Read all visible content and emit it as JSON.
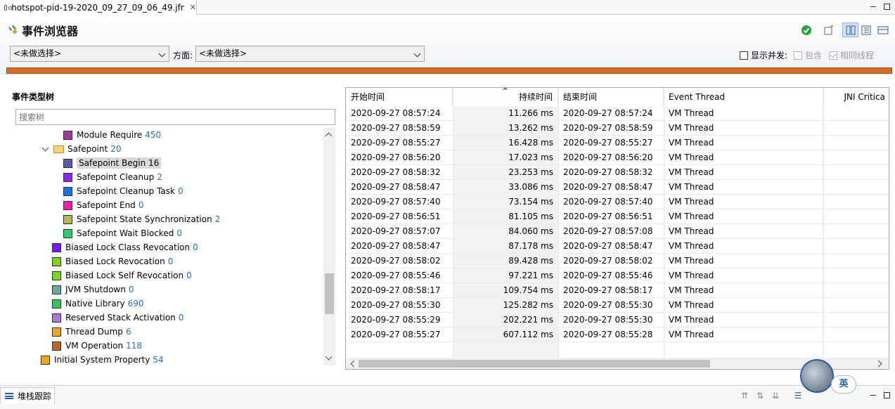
{
  "editor_tab": {
    "title": "hotspot-pid-19-2020_09_27_09_06_49.jfr",
    "close": "✕"
  },
  "header": {
    "title": "事件浏览器",
    "combo1": "<未做选择>",
    "aspect_label": "方面:",
    "combo2": "<未做选择>",
    "show_concurrent": "显示并发:",
    "contains": "包含",
    "same_thread": "相同线程"
  },
  "tree": {
    "title": "事件类型树",
    "search_placeholder": "搜索树",
    "nodes": [
      {
        "label": "Module Require",
        "count": "450",
        "color": "#a23a98"
      },
      {
        "label": "Safepoint",
        "count": "20"
      },
      {
        "label": "Safepoint Begin",
        "count": "16",
        "color": "#5b5aa8"
      },
      {
        "label": "Safepoint Cleanup",
        "count": "2",
        "color": "#8a2be2"
      },
      {
        "label": "Safepoint Cleanup Task",
        "count": "0",
        "color": "#1e6fd9"
      },
      {
        "label": "Safepoint End",
        "count": "0",
        "color": "#ff1aa6"
      },
      {
        "label": "Safepoint State Synchronization",
        "count": "2",
        "color": "#b5b55a"
      },
      {
        "label": "Safepoint Wait Blocked",
        "count": "0",
        "color": "#2fd06a"
      },
      {
        "label": "Biased Lock Class Revocation",
        "count": "0",
        "color": "#6f1cff"
      },
      {
        "label": "Biased Lock Revocation",
        "count": "0",
        "color": "#7ed321"
      },
      {
        "label": "Biased Lock Self Revocation",
        "count": "0",
        "color": "#7ed321"
      },
      {
        "label": "JVM Shutdown",
        "count": "0",
        "color": "#6aa8a0"
      },
      {
        "label": "Native Library",
        "count": "690",
        "color": "#35c45a"
      },
      {
        "label": "Reserved Stack Activation",
        "count": "0",
        "color": "#a77bd6"
      },
      {
        "label": "Thread Dump",
        "count": "6",
        "color": "#f5a524"
      },
      {
        "label": "VM Operation",
        "count": "118",
        "color": "#b8692a"
      },
      {
        "label": "Initial System Property",
        "count": "54",
        "color": "#f5a524"
      }
    ]
  },
  "table": {
    "columns": [
      "开始时间",
      "持续时间",
      "结束时间",
      "Event Thread",
      "JNI Critica"
    ],
    "sort_indicator": "^",
    "rows": [
      [
        "2020-09-27 08:57:24",
        "11.266 ms",
        "2020-09-27 08:57:24",
        "VM Thread"
      ],
      [
        "2020-09-27 08:58:59",
        "13.262 ms",
        "2020-09-27 08:58:59",
        "VM Thread"
      ],
      [
        "2020-09-27 08:55:27",
        "16.428 ms",
        "2020-09-27 08:55:27",
        "VM Thread"
      ],
      [
        "2020-09-27 08:56:20",
        "17.023 ms",
        "2020-09-27 08:56:20",
        "VM Thread"
      ],
      [
        "2020-09-27 08:58:32",
        "23.253 ms",
        "2020-09-27 08:58:32",
        "VM Thread"
      ],
      [
        "2020-09-27 08:58:47",
        "33.086 ms",
        "2020-09-27 08:58:47",
        "VM Thread"
      ],
      [
        "2020-09-27 08:57:40",
        "73.154 ms",
        "2020-09-27 08:57:40",
        "VM Thread"
      ],
      [
        "2020-09-27 08:56:51",
        "81.105 ms",
        "2020-09-27 08:56:51",
        "VM Thread"
      ],
      [
        "2020-09-27 08:57:07",
        "84.060 ms",
        "2020-09-27 08:57:08",
        "VM Thread"
      ],
      [
        "2020-09-27 08:58:47",
        "87.178 ms",
        "2020-09-27 08:58:47",
        "VM Thread"
      ],
      [
        "2020-09-27 08:58:02",
        "89.428 ms",
        "2020-09-27 08:58:02",
        "VM Thread"
      ],
      [
        "2020-09-27 08:55:46",
        "97.221 ms",
        "2020-09-27 08:55:46",
        "VM Thread"
      ],
      [
        "2020-09-27 08:58:17",
        "109.754 ms",
        "2020-09-27 08:58:17",
        "VM Thread"
      ],
      [
        "2020-09-27 08:55:30",
        "125.282 ms",
        "2020-09-27 08:55:30",
        "VM Thread"
      ],
      [
        "2020-09-27 08:55:29",
        "202.221 ms",
        "2020-09-27 08:55:30",
        "VM Thread"
      ],
      [
        "2020-09-27 08:55:27",
        "607.112 ms",
        "2020-09-27 08:55:28",
        "VM Thread"
      ]
    ]
  },
  "bottom": {
    "tab_label": "堆栈跟踪",
    "ime_label": "英"
  },
  "colors": {
    "progress": "#e06a1c",
    "count_text": "#1e6fb8",
    "accent": "#2a5db0"
  }
}
